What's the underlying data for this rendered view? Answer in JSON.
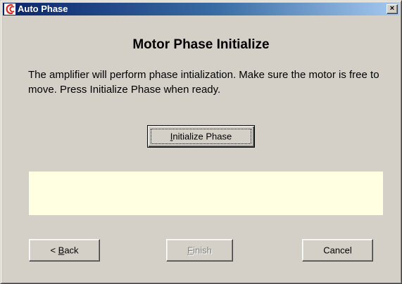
{
  "window": {
    "title": "Auto Phase",
    "close_glyph": "×",
    "icon": "copley-logo-icon"
  },
  "main": {
    "heading": "Motor Phase Initialize",
    "description": "The amplifier  will perform phase intialization. Make sure the motor is free to move.  Press Initialize Phase when ready.",
    "status_text": ""
  },
  "buttons": {
    "initialize": {
      "mnemonic": "I",
      "rest": "nitialize Phase"
    },
    "back": {
      "prefix": "< ",
      "mnemonic": "B",
      "rest": "ack"
    },
    "finish": {
      "mnemonic": "F",
      "rest": "inish",
      "enabled": false
    },
    "cancel": {
      "label": "Cancel"
    }
  },
  "colors": {
    "dialog_bg": "#d4d0c8",
    "title_start": "#0a246a",
    "title_end": "#a6caf0",
    "status_bg": "#ffffe1",
    "logo": "#e0231a"
  }
}
